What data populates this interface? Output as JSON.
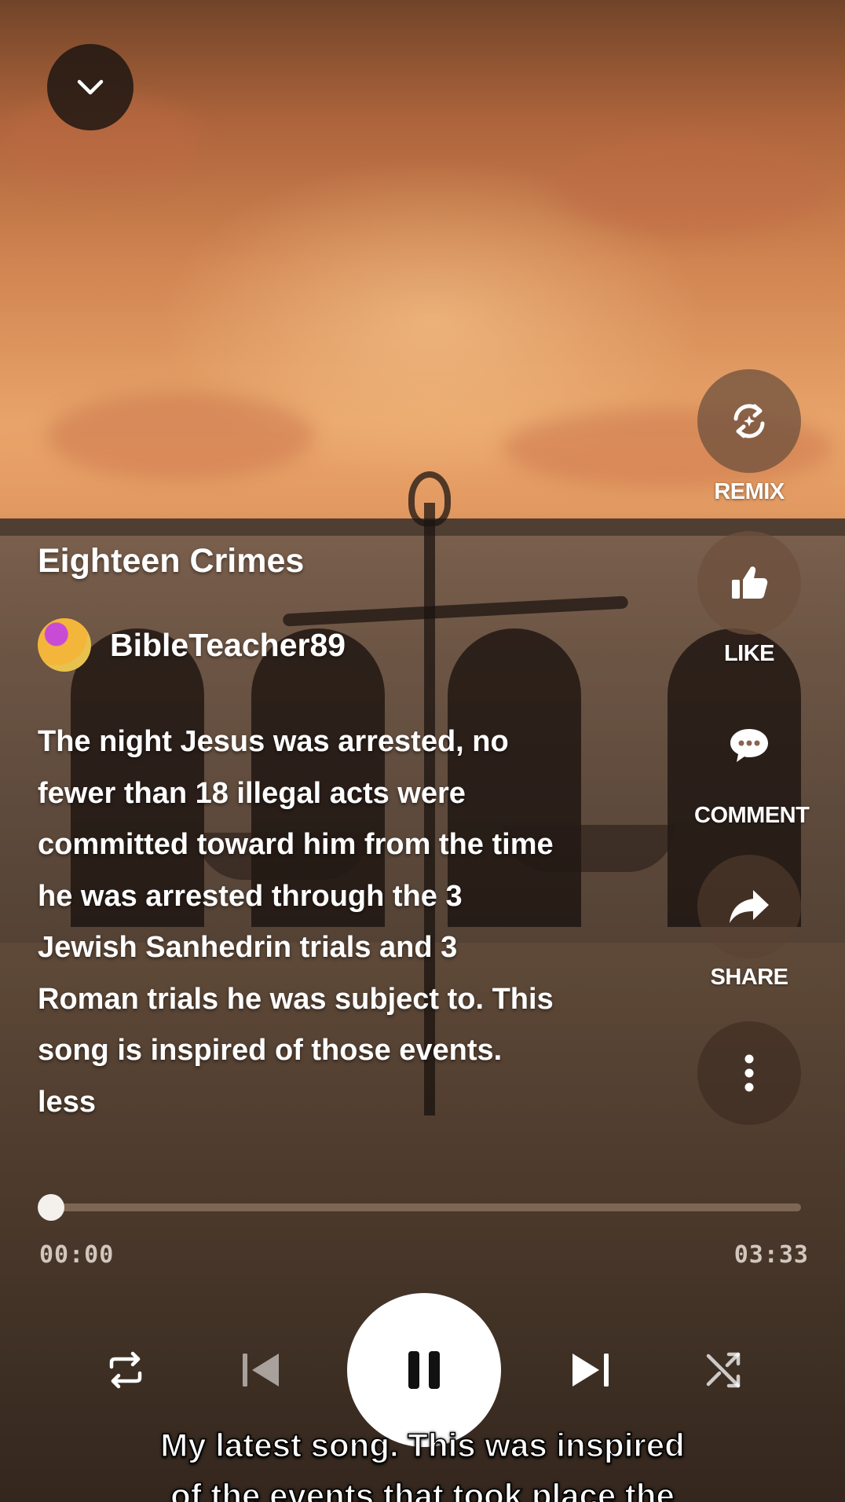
{
  "song": {
    "title": "Eighteen Crimes",
    "artist": "BibleTeacher89",
    "description_lines": [
      "The night Jesus was arrested, no",
      "fewer than 18 illegal acts were",
      "committed toward him from the time",
      "he was arrested through the 3",
      "Jewish Sanhedrin trials and 3",
      "Roman trials he was subject to. This",
      "song is inspired of those events."
    ],
    "less_label": "less"
  },
  "actions": {
    "remix": {
      "label": "REMIX",
      "icon": "remix-icon"
    },
    "like": {
      "label": "LIKE",
      "icon": "thumbs-up-icon"
    },
    "comment": {
      "label": "COMMENT",
      "icon": "comment-icon"
    },
    "share": {
      "label": "SHARE",
      "icon": "share-arrow-icon"
    },
    "more": {
      "icon": "more-vertical-icon"
    }
  },
  "player": {
    "current_time": "00:00",
    "total_time": "03:33",
    "progress_fraction": 0.0,
    "state": "playing",
    "controls": [
      "repeat-icon",
      "previous-icon",
      "pause-icon",
      "next-icon",
      "shuffle-icon"
    ]
  },
  "caption": {
    "lines": [
      "My latest song. This was inspired",
      "of the events that took place the"
    ]
  },
  "top": {
    "collapse_icon": "chevron-down-icon"
  },
  "colors": {
    "accent": "#ffffff",
    "sky": "#e8a46a",
    "action_bg": "#6e503e"
  }
}
